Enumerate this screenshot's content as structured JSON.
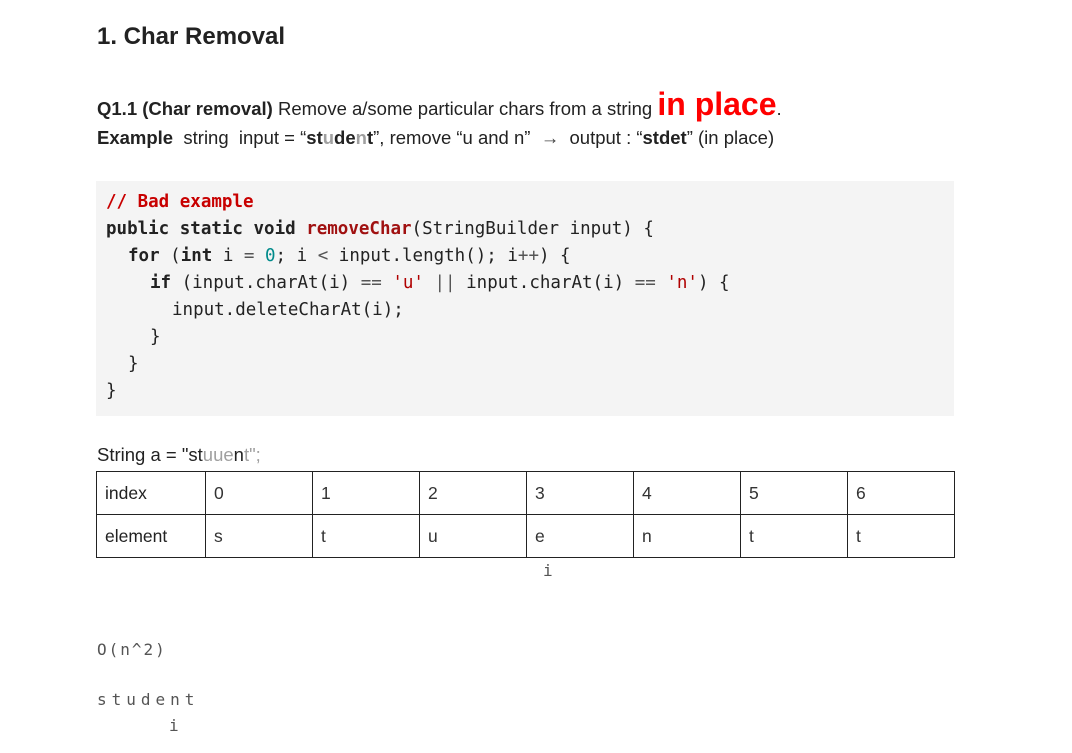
{
  "heading": "1. Char Removal",
  "question": {
    "label": "Q1.1 (Char removal)",
    "text": " Remove a/some particular chars from a string ",
    "emphasis": "in place",
    "end": "."
  },
  "example": {
    "label": "Example",
    "t1": "  string  input = “",
    "w1": "st",
    "w2": "u",
    "w3": "de",
    "w4": "n",
    "w5": "t",
    "t2": "”, remove “u and n”  ",
    "arrow": "→",
    "t3": "  output : “",
    "out": "stdet",
    "t4": "” (in place)"
  },
  "code": {
    "comment": "// Bad example",
    "l2_kw": "public static void ",
    "l2_fn": "removeChar",
    "l2_rest": "(StringBuilder input) {",
    "l3_kw": "for",
    "l3_a": " (",
    "l3_int": "int",
    "l3_b": " i ",
    "l3_eq": "=",
    "l3_sp": " ",
    "l3_zero": "0",
    "l3_c": "; i ",
    "l3_lt": "<",
    "l3_d": " input.length(); i",
    "l3_pp": "++",
    "l3_e": ") {",
    "l4_kw": "if",
    "l4_a": " (input.charAt(i) ",
    "l4_eq1": "==",
    "l4_sp1": " ",
    "l4_u": "'u'",
    "l4_sp2": " ",
    "l4_or": "||",
    "l4_b": " input.charAt(i) ",
    "l4_eq2": "==",
    "l4_sp3": " ",
    "l4_n": "'n'",
    "l4_c": ") {",
    "l5": "input.deleteCharAt(i);",
    "l6": "}",
    "l7": "}",
    "l8": "}"
  },
  "string_a": {
    "pre": "String a = \"st",
    "gray": "uue",
    "mid": "n",
    "post": "t\";"
  },
  "table": {
    "row_index_label": "index",
    "row_element_label": "element",
    "indices": [
      "0",
      "1",
      "2",
      "3",
      "4",
      "5",
      "6"
    ],
    "elements": [
      "s",
      "t",
      "u",
      "e",
      "n",
      "t",
      "t"
    ]
  },
  "pointer_1": "i",
  "complexity": "O(n^2)",
  "word": "student",
  "pointer_2": "i"
}
